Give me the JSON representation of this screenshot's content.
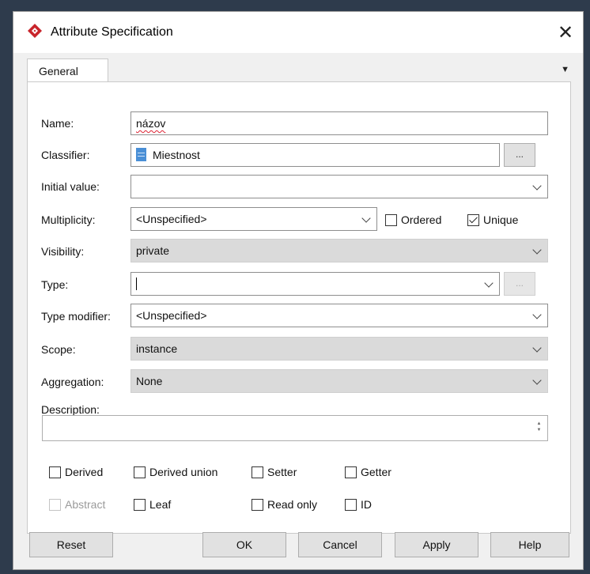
{
  "window": {
    "title": "Attribute Specification",
    "close": "✕"
  },
  "tabs": [
    {
      "label": "General"
    }
  ],
  "tab_menu": "▼",
  "form": {
    "name": {
      "label": "Name:",
      "value": "názov"
    },
    "classifier": {
      "label": "Classifier:",
      "value": "Miestnost",
      "browse": "..."
    },
    "initial_value": {
      "label": "Initial value:",
      "value": ""
    },
    "multiplicity": {
      "label": "Multiplicity:",
      "value": "<Unspecified>"
    },
    "ordered": {
      "label": "Ordered",
      "checked": false
    },
    "unique": {
      "label": "Unique",
      "checked": true
    },
    "visibility": {
      "label": "Visibility:",
      "value": "private"
    },
    "type": {
      "label": "Type:",
      "value": "",
      "browse": "..."
    },
    "type_modifier": {
      "label": "Type modifier:",
      "value": "<Unspecified>"
    },
    "scope": {
      "label": "Scope:",
      "value": "instance"
    },
    "aggregation": {
      "label": "Aggregation:",
      "value": "None"
    },
    "description": {
      "label": "Description:",
      "value": "",
      "spin_up": "▲",
      "spin_down": "▼"
    }
  },
  "flags": {
    "derived": {
      "label": "Derived",
      "checked": false
    },
    "derived_union": {
      "label": "Derived union",
      "checked": false
    },
    "setter": {
      "label": "Setter",
      "checked": false
    },
    "getter": {
      "label": "Getter",
      "checked": false
    },
    "abstract": {
      "label": "Abstract",
      "checked": false,
      "disabled": true
    },
    "leaf": {
      "label": "Leaf",
      "checked": false
    },
    "read_only": {
      "label": "Read only",
      "checked": false
    },
    "id": {
      "label": "ID",
      "checked": false
    }
  },
  "buttons": {
    "reset": "Reset",
    "ok": "OK",
    "cancel": "Cancel",
    "apply": "Apply",
    "help": "Help"
  },
  "colors": {
    "window_bg": "#2e3b4c",
    "dialog_bg": "#f0f0f0",
    "disabled_field": "#dadada",
    "app_icon": "#c8242b"
  }
}
